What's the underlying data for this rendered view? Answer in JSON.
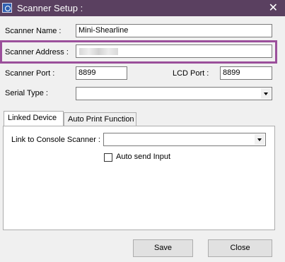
{
  "window": {
    "title": "Scanner Setup :",
    "app_icon": "scanner-app-icon",
    "close_symbol": "✕"
  },
  "form": {
    "scanner_name": {
      "label": "Scanner Name :",
      "value": "Mini-Shearline"
    },
    "scanner_address": {
      "label": "Scanner Address :",
      "value": ""
    },
    "scanner_port": {
      "label": "Scanner Port :",
      "value": "8899"
    },
    "lcd_port": {
      "label": "LCD Port :",
      "value": "8899"
    },
    "serial_type": {
      "label": "Serial Type :",
      "value": ""
    }
  },
  "tabs": [
    {
      "label": "Linked Device",
      "active": true
    },
    {
      "label": "Auto Print Function",
      "active": false
    }
  ],
  "linked_device": {
    "console_label": "Link to Console Scanner :",
    "console_value": "",
    "auto_send_label": "Auto send Input",
    "auto_send_checked": false
  },
  "buttons": {
    "save": "Save",
    "close": "Close"
  },
  "colors": {
    "titlebar": "#5a4060",
    "highlight": "#9b4f9b",
    "window_bg": "#f0f0f0"
  }
}
